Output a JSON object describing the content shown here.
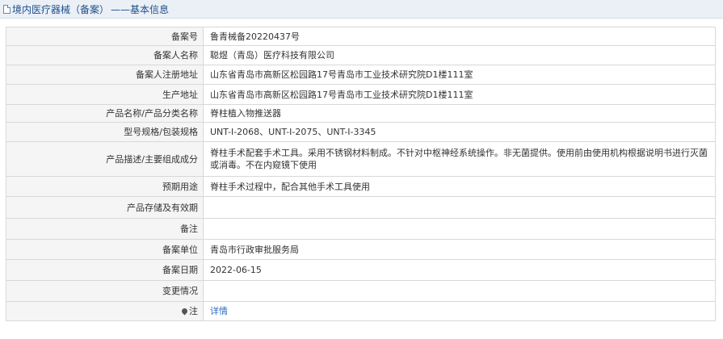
{
  "header": {
    "title": "境内医疗器械（备案）",
    "subtitle": "——基本信息"
  },
  "rows": [
    {
      "label": "备案号",
      "value": "鲁青械备20220437号"
    },
    {
      "label": "备案人名称",
      "value": "聪煜（青岛）医疗科技有限公司"
    },
    {
      "label": "备案人注册地址",
      "value": "山东省青岛市高新区松园路17号青岛市工业技术研究院D1楼111室"
    },
    {
      "label": "生产地址",
      "value": "山东省青岛市高新区松园路17号青岛市工业技术研究院D1楼111室"
    },
    {
      "label": "产品名称/产品分类名称",
      "value": "脊柱植入物推送器"
    },
    {
      "label": "型号规格/包装规格",
      "value": "UNT-I-2068、UNT-I-2075、UNT-I-3345"
    },
    {
      "label": "产品描述/主要组成成分",
      "value": "脊柱手术配套手术工具。采用不锈钢材料制成。不针对中枢神经系统操作。非无菌提供。使用前由使用机构根据说明书进行灭菌或消毒。不在内窥镜下使用"
    },
    {
      "label": "预期用途",
      "value": "脊柱手术过程中，配合其他手术工具使用"
    },
    {
      "label": "产品存储及有效期",
      "value": ""
    },
    {
      "label": "备注",
      "value": ""
    },
    {
      "label": "备案单位",
      "value": "青岛市行政审批服务局"
    },
    {
      "label": "备案日期",
      "value": "2022-06-15"
    },
    {
      "label": "变更情况",
      "value": ""
    }
  ],
  "note_row": {
    "label": "注",
    "link_text": "详情"
  }
}
